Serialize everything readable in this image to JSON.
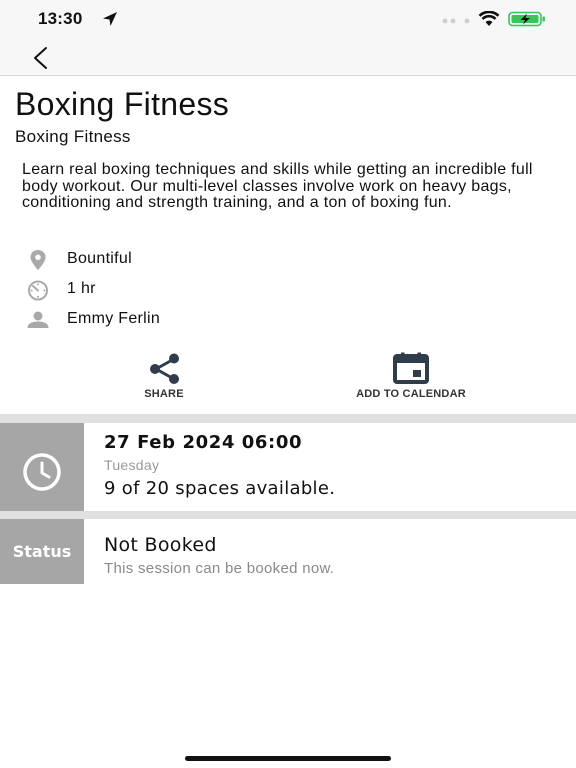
{
  "status_bar": {
    "time": "13:30",
    "icons": [
      "location-arrow-icon",
      "signal-dots-icon",
      "wifi-icon",
      "battery-charging-icon"
    ]
  },
  "nav": {
    "back_icon": "chevron-left-icon"
  },
  "class": {
    "title": "Boxing Fitness",
    "subtitle": "Boxing Fitness",
    "description": "Learn real boxing techniques and skills while getting an incredible full body workout. Our multi-level classes involve work on heavy bags, conditioning and strength training, and a ton of boxing fun.",
    "location": "Bountiful",
    "duration": "1 hr",
    "instructor": "Emmy Ferlin"
  },
  "actions": {
    "share_label": "SHARE",
    "calendar_label": "ADD TO CALENDAR"
  },
  "session": {
    "date": "27 Feb 2024  06:00",
    "day": "Tuesday",
    "spaces": "9 of 20 spaces available."
  },
  "booking": {
    "side_label": "Status",
    "status": "Not Booked",
    "note": "This session can be booked now."
  },
  "colors": {
    "side_panel": "#a6a6a6",
    "divider": "#e0e0e0",
    "icon_dark": "#2f3d4a",
    "battery_green": "#33c659"
  }
}
